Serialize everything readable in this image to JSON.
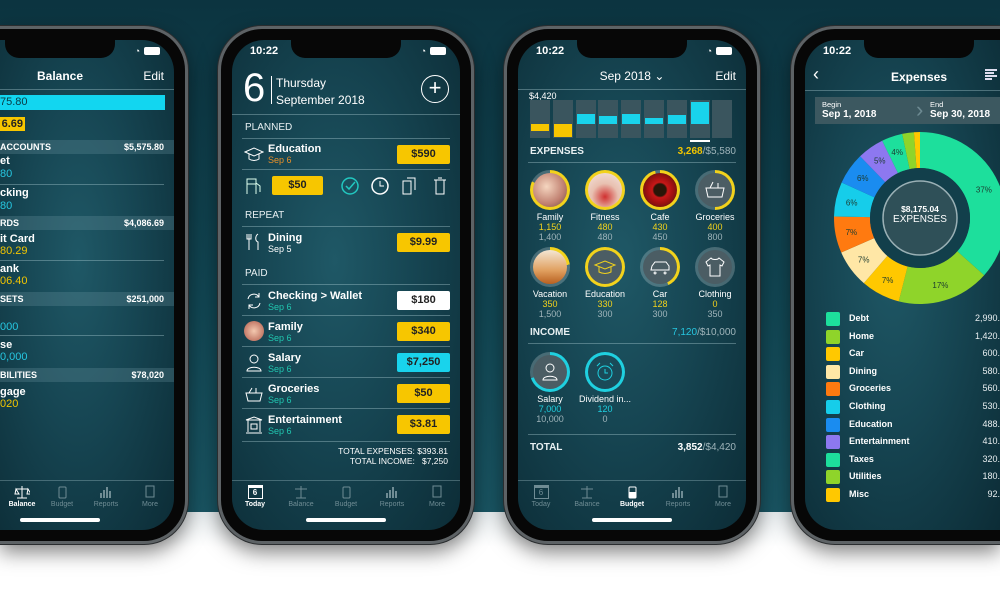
{
  "status_time": "10:22",
  "tabs": {
    "today": "Today",
    "today_day": "6",
    "balance": "Balance",
    "budget": "Budget",
    "reports": "Reports",
    "more": "More"
  },
  "balance": {
    "title": "Balance",
    "edit": "Edit",
    "total_fragment": "75.80",
    "cards_fragment": "6.69",
    "sections": [
      {
        "label": "ACCOUNTS",
        "total": "$5,575.80",
        "items": [
          {
            "name": "et",
            "amount": "80"
          },
          {
            "name": "cking",
            "amount": "80"
          }
        ]
      },
      {
        "label": "RDS",
        "total": "$4,086.69",
        "items": [
          {
            "name": "it Card",
            "amount": "80.29"
          },
          {
            "name": "ank",
            "amount": "06.40"
          }
        ]
      },
      {
        "label": "SETS",
        "total": "$251,000",
        "items": [
          {
            "amount": "000"
          },
          {
            "name": "se",
            "amount": "0,000"
          }
        ]
      },
      {
        "label": "BILITIES",
        "total": "$78,020",
        "items": [
          {
            "name": "gage",
            "amount": "020"
          }
        ]
      }
    ]
  },
  "today": {
    "day": "6",
    "weekday": "Thursday",
    "month_year": "September 2018",
    "planned_label": "PLANNED",
    "repeat_label": "REPEAT",
    "paid_label": "PAID",
    "planned": {
      "name": "Education",
      "date": "Sep 6",
      "amount": "$590"
    },
    "quick_amount": "$50",
    "repeat": {
      "name": "Dining",
      "date": "Sep 5",
      "amount": "$9.99"
    },
    "paid": [
      {
        "name": "Checking > Wallet",
        "date": "Sep 6",
        "amount": "$180",
        "color": "#ffffff"
      },
      {
        "name": "Family",
        "date": "Sep 6",
        "amount": "$340",
        "color": "#f7c600"
      },
      {
        "name": "Salary",
        "date": "Sep 6",
        "amount": "$7,250",
        "color": "#19d3ec"
      },
      {
        "name": "Groceries",
        "date": "Sep 6",
        "amount": "$50",
        "color": "#f7c600"
      },
      {
        "name": "Entertainment",
        "date": "Sep 6",
        "amount": "$3.81",
        "color": "#f7c600"
      }
    ],
    "total_expenses": "TOTAL EXPENSES: $393.81",
    "total_income": "TOTAL INCOME:   $7,250"
  },
  "budget": {
    "period": "Sep 2018",
    "edit": "Edit",
    "scale_label": "$4,420",
    "bars": [
      -0.18,
      -0.32,
      0.26,
      0.2,
      0.26,
      0.14,
      0.22,
      0.55,
      0
    ],
    "expenses_label": "EXPENSES",
    "expenses_spent": "3,268",
    "expenses_budget": "/$5,580",
    "categories": [
      {
        "name": "Family",
        "spent": "1,150",
        "budget": "1,400",
        "progress": 0.82,
        "fill": "photo-family"
      },
      {
        "name": "Fitness",
        "spent": "480",
        "budget": "480",
        "progress": 1,
        "fill": "photo-fitness"
      },
      {
        "name": "Cafe",
        "spent": "430",
        "budget": "450",
        "progress": 0.96,
        "fill": "photo-cafe"
      },
      {
        "name": "Groceries",
        "spent": "400",
        "budget": "800",
        "progress": 0.5,
        "fill": "basket-icon"
      },
      {
        "name": "Vacation",
        "spent": "350",
        "budget": "1,500",
        "progress": 0.23,
        "fill": "photo-vacation"
      },
      {
        "name": "Education",
        "spent": "330",
        "budget": "300",
        "progress": 1,
        "fill": "graduation-cap-icon"
      },
      {
        "name": "Car",
        "spent": "128",
        "budget": "300",
        "progress": 0.43,
        "fill": "car-icon"
      },
      {
        "name": "Clothing",
        "spent": "0",
        "budget": "350",
        "progress": 0,
        "fill": "shirt-icon"
      }
    ],
    "income_label": "INCOME",
    "income_received": "7,120",
    "income_budget": "/$10,000",
    "income": [
      {
        "name": "Salary",
        "received": "7,000",
        "budget": "10,000",
        "progress": 0.7
      },
      {
        "name": "Dividend in...",
        "received": "120",
        "budget": "0",
        "progress": 1
      }
    ],
    "total_label": "TOTAL",
    "total_value": "3,852",
    "total_budget": "/$4,420",
    "colors": {
      "expense": "#f2d21c",
      "income": "#1fd0e0"
    }
  },
  "expenses": {
    "title": "Expenses",
    "begin_label": "Begin",
    "begin_date": "Sep 1, 2018",
    "end_label": "End",
    "end_date": "Sep 30, 2018",
    "center_amount": "$8,175.04",
    "center_label": "EXPENSES"
  },
  "chart_data": {
    "type": "pie",
    "title": "Expenses",
    "total": 8175.04,
    "categories": [
      "Debt",
      "Home",
      "Car",
      "Dining",
      "Groceries",
      "Clothing",
      "Education",
      "Entertainment",
      "Taxes",
      "Utilities",
      "Misc"
    ],
    "values": [
      2990,
      1420,
      600,
      580,
      560,
      530,
      488,
      410,
      320,
      180,
      92
    ],
    "value_labels": [
      "2,990.",
      "1,420.",
      "600.",
      "580.",
      "560.",
      "530.",
      "488.",
      "410.",
      "320.",
      "180.",
      "92."
    ],
    "percent_labels": [
      "37%",
      "17%",
      "7%",
      "7%",
      "7%",
      "6%",
      "6%",
      "5%",
      "4%",
      "",
      ""
    ],
    "colors": [
      "#1ddf9c",
      "#8fd42a",
      "#ffc800",
      "#ffe7a6",
      "#ff7a10",
      "#16cdea",
      "#1a8cf0",
      "#8d78f0",
      "#1ddf9c",
      "#8fd42a",
      "#ffc800"
    ],
    "legend": "below"
  }
}
